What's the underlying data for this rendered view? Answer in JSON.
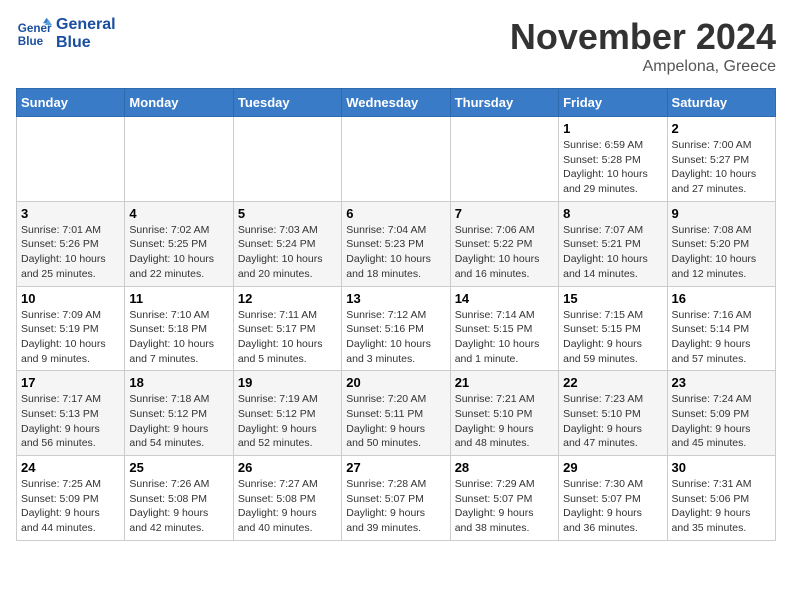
{
  "logo": {
    "line1": "General",
    "line2": "Blue"
  },
  "title": "November 2024",
  "location": "Ampelona, Greece",
  "weekdays": [
    "Sunday",
    "Monday",
    "Tuesday",
    "Wednesday",
    "Thursday",
    "Friday",
    "Saturday"
  ],
  "weeks": [
    [
      {
        "day": "",
        "info": ""
      },
      {
        "day": "",
        "info": ""
      },
      {
        "day": "",
        "info": ""
      },
      {
        "day": "",
        "info": ""
      },
      {
        "day": "",
        "info": ""
      },
      {
        "day": "1",
        "info": "Sunrise: 6:59 AM\nSunset: 5:28 PM\nDaylight: 10 hours\nand 29 minutes."
      },
      {
        "day": "2",
        "info": "Sunrise: 7:00 AM\nSunset: 5:27 PM\nDaylight: 10 hours\nand 27 minutes."
      }
    ],
    [
      {
        "day": "3",
        "info": "Sunrise: 7:01 AM\nSunset: 5:26 PM\nDaylight: 10 hours\nand 25 minutes."
      },
      {
        "day": "4",
        "info": "Sunrise: 7:02 AM\nSunset: 5:25 PM\nDaylight: 10 hours\nand 22 minutes."
      },
      {
        "day": "5",
        "info": "Sunrise: 7:03 AM\nSunset: 5:24 PM\nDaylight: 10 hours\nand 20 minutes."
      },
      {
        "day": "6",
        "info": "Sunrise: 7:04 AM\nSunset: 5:23 PM\nDaylight: 10 hours\nand 18 minutes."
      },
      {
        "day": "7",
        "info": "Sunrise: 7:06 AM\nSunset: 5:22 PM\nDaylight: 10 hours\nand 16 minutes."
      },
      {
        "day": "8",
        "info": "Sunrise: 7:07 AM\nSunset: 5:21 PM\nDaylight: 10 hours\nand 14 minutes."
      },
      {
        "day": "9",
        "info": "Sunrise: 7:08 AM\nSunset: 5:20 PM\nDaylight: 10 hours\nand 12 minutes."
      }
    ],
    [
      {
        "day": "10",
        "info": "Sunrise: 7:09 AM\nSunset: 5:19 PM\nDaylight: 10 hours\nand 9 minutes."
      },
      {
        "day": "11",
        "info": "Sunrise: 7:10 AM\nSunset: 5:18 PM\nDaylight: 10 hours\nand 7 minutes."
      },
      {
        "day": "12",
        "info": "Sunrise: 7:11 AM\nSunset: 5:17 PM\nDaylight: 10 hours\nand 5 minutes."
      },
      {
        "day": "13",
        "info": "Sunrise: 7:12 AM\nSunset: 5:16 PM\nDaylight: 10 hours\nand 3 minutes."
      },
      {
        "day": "14",
        "info": "Sunrise: 7:14 AM\nSunset: 5:15 PM\nDaylight: 10 hours\nand 1 minute."
      },
      {
        "day": "15",
        "info": "Sunrise: 7:15 AM\nSunset: 5:15 PM\nDaylight: 9 hours\nand 59 minutes."
      },
      {
        "day": "16",
        "info": "Sunrise: 7:16 AM\nSunset: 5:14 PM\nDaylight: 9 hours\nand 57 minutes."
      }
    ],
    [
      {
        "day": "17",
        "info": "Sunrise: 7:17 AM\nSunset: 5:13 PM\nDaylight: 9 hours\nand 56 minutes."
      },
      {
        "day": "18",
        "info": "Sunrise: 7:18 AM\nSunset: 5:12 PM\nDaylight: 9 hours\nand 54 minutes."
      },
      {
        "day": "19",
        "info": "Sunrise: 7:19 AM\nSunset: 5:12 PM\nDaylight: 9 hours\nand 52 minutes."
      },
      {
        "day": "20",
        "info": "Sunrise: 7:20 AM\nSunset: 5:11 PM\nDaylight: 9 hours\nand 50 minutes."
      },
      {
        "day": "21",
        "info": "Sunrise: 7:21 AM\nSunset: 5:10 PM\nDaylight: 9 hours\nand 48 minutes."
      },
      {
        "day": "22",
        "info": "Sunrise: 7:23 AM\nSunset: 5:10 PM\nDaylight: 9 hours\nand 47 minutes."
      },
      {
        "day": "23",
        "info": "Sunrise: 7:24 AM\nSunset: 5:09 PM\nDaylight: 9 hours\nand 45 minutes."
      }
    ],
    [
      {
        "day": "24",
        "info": "Sunrise: 7:25 AM\nSunset: 5:09 PM\nDaylight: 9 hours\nand 44 minutes."
      },
      {
        "day": "25",
        "info": "Sunrise: 7:26 AM\nSunset: 5:08 PM\nDaylight: 9 hours\nand 42 minutes."
      },
      {
        "day": "26",
        "info": "Sunrise: 7:27 AM\nSunset: 5:08 PM\nDaylight: 9 hours\nand 40 minutes."
      },
      {
        "day": "27",
        "info": "Sunrise: 7:28 AM\nSunset: 5:07 PM\nDaylight: 9 hours\nand 39 minutes."
      },
      {
        "day": "28",
        "info": "Sunrise: 7:29 AM\nSunset: 5:07 PM\nDaylight: 9 hours\nand 38 minutes."
      },
      {
        "day": "29",
        "info": "Sunrise: 7:30 AM\nSunset: 5:07 PM\nDaylight: 9 hours\nand 36 minutes."
      },
      {
        "day": "30",
        "info": "Sunrise: 7:31 AM\nSunset: 5:06 PM\nDaylight: 9 hours\nand 35 minutes."
      }
    ]
  ]
}
